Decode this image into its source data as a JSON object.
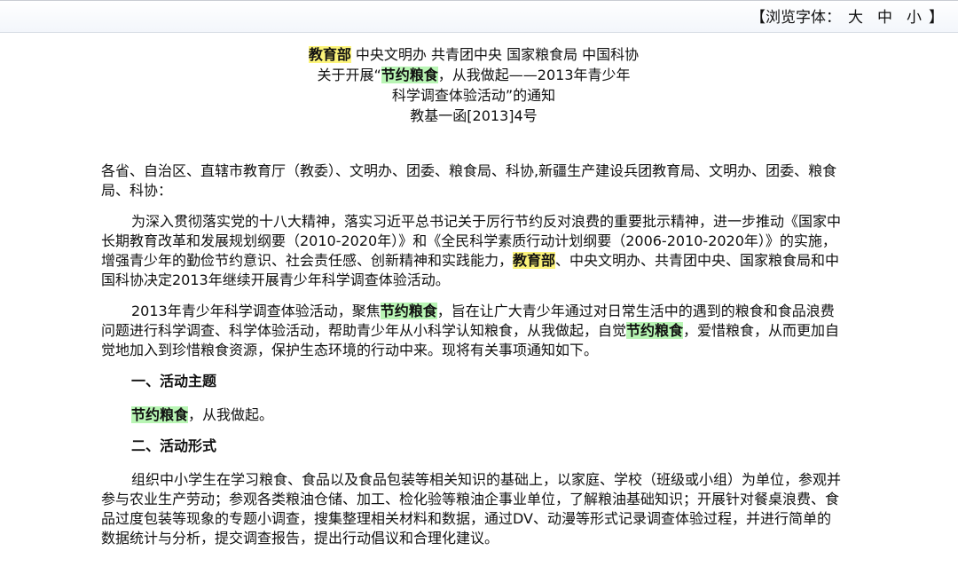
{
  "toolbar": {
    "prefix": "【浏览字体：",
    "big": "大",
    "medium": "中",
    "small": "小",
    "suffix": "】"
  },
  "header": {
    "issuer_highlight": "教育部",
    "issuer_rest": " 中央文明办 共青团中央 国家粮食局 中国科协",
    "title_pre": "关于开展“",
    "title_highlight": "节约粮食",
    "title_rest": "，从我做起——2013年青少年",
    "title_line3": "科学调查体验活动”的通知",
    "doc_number": "教基一函[2013]4号"
  },
  "body": {
    "salutation": "各省、自治区、直辖市教育厅（教委）、文明办、团委、粮食局、科协,新疆生产建设兵团教育局、文明办、团委、粮食局、科协：",
    "para1_a": "为深入贯彻落实党的十八大精神，落实习近平总书记关于厉行节约反对浪费的重要批示精神，进一步推动《国家中长期教育改革和发展规划纲要（2010-2020年）》和《全民科学素质行动计划纲要（2006-2010-2020年）》的实施，增强青少年的勤俭节约意识、社会责任感、创新精神和实践能力，",
    "para1_hl": "教育部",
    "para1_b": "、中央文明办、共青团中央、国家粮食局和中国科协决定2013年继续开展青少年科学调查体验活动。",
    "para2_a": "2013年青少年科学调查体验活动，聚焦",
    "para2_hl1": "节约粮食",
    "para2_b": "，旨在让广大青少年通过对日常生活中的遇到的粮食和食品浪费问题进行科学调查、科学体验活动，帮助青少年从小科学认知粮食，从我做起，自觉",
    "para2_hl2": "节约粮食",
    "para2_c": "，爱惜粮食，从而更加自觉地加入到珍惜粮食资源，保护生态环境的行动中来。现将有关事项通知如下。",
    "heading1": "一、活动主题",
    "theme_hl": "节约粮食",
    "theme_rest": "，从我做起。",
    "heading2": "二、活动形式",
    "para3": "组织中小学生在学习粮食、食品以及食品包装等相关知识的基础上，以家庭、学校（班级或小组）为单位，参观并参与农业生产劳动；参观各类粮油仓储、加工、检化验等粮油企事业单位，了解粮油基础知识；开展针对餐桌浪费、食品过度包装等现象的专题小调查，搜集整理相关材料和数据，通过DV、动漫等形式记录调查体验过程，并进行简单的数据统计与分析，提交调查报告，提出行动倡议和合理化建议。"
  }
}
